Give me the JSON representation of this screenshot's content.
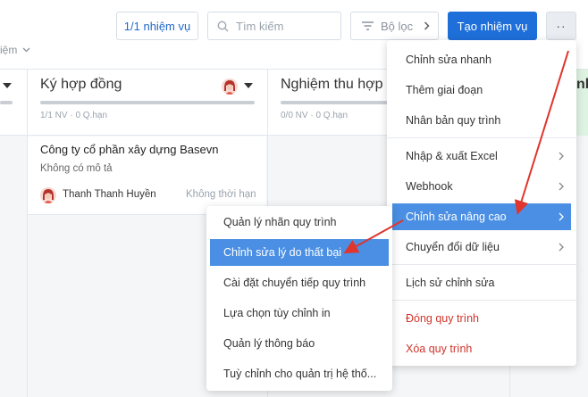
{
  "toolbar": {
    "task_count_label": "1/1 nhiệm vụ",
    "search_placeholder": "Tìm kiếm",
    "filter_label": "Bộ lọc",
    "create_label": "Tạo nhiệm vụ",
    "more_label": "··",
    "left_partial_label": "iệm"
  },
  "columns": [
    {
      "title": "Ký hợp đồng",
      "meta": "1/1 NV · 0 Q.hạn"
    },
    {
      "title": "Nghiệm thu hợp đ",
      "meta": "0/0 NV · 0 Q.hạn"
    },
    {
      "title": "nh"
    }
  ],
  "card": {
    "title": "Công ty cổ phần xây dựng Basevn",
    "description": "Không có mô tả",
    "assignee": "Thanh Thanh Huyền",
    "due": "Không thời hạn"
  },
  "main_menu": {
    "items": [
      {
        "label": "Chỉnh sửa nhanh"
      },
      {
        "label": "Thêm giai đoạn"
      },
      {
        "label": "Nhân bản quy trình"
      },
      {
        "label": "Nhập & xuất Excel"
      },
      {
        "label": "Webhook"
      },
      {
        "label": "Chỉnh sửa nâng cao"
      },
      {
        "label": "Chuyển đổi dữ liệu"
      },
      {
        "label": "Lịch sử chỉnh sửa"
      },
      {
        "label": "Đóng quy trình"
      },
      {
        "label": "Xóa quy trình"
      }
    ]
  },
  "sub_menu": {
    "items": [
      {
        "label": "Quản lý nhãn quy trình"
      },
      {
        "label": "Chỉnh sửa lý do thất bại"
      },
      {
        "label": "Cài đặt chuyển tiếp quy trình"
      },
      {
        "label": "Lựa chọn tùy chỉnh in"
      },
      {
        "label": "Quản lý thông báo"
      },
      {
        "label": "Tuỳ chỉnh cho quản trị hệ thố..."
      }
    ]
  },
  "colors": {
    "primary": "#1e6fd9",
    "highlight": "#4a8fe3",
    "danger": "#d0342c",
    "annotation_arrow": "#e0342c"
  }
}
